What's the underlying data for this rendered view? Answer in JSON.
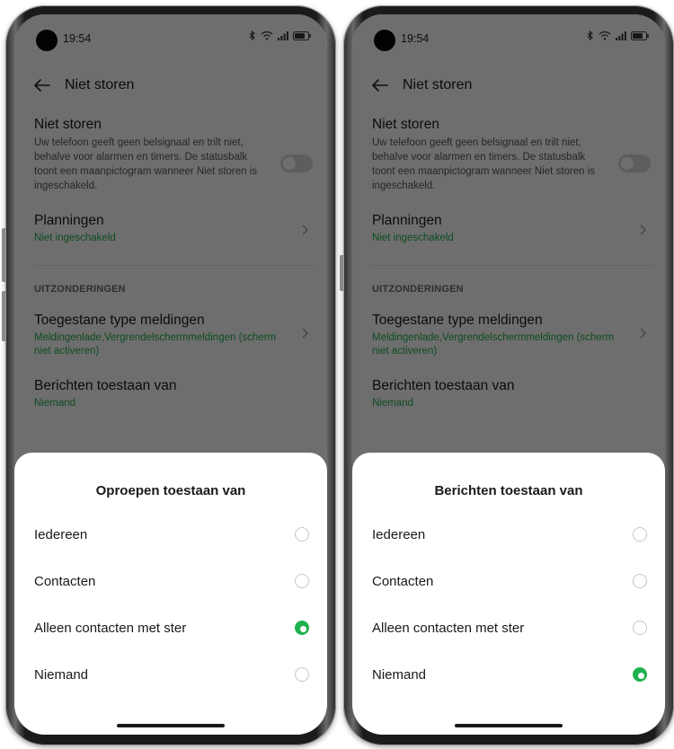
{
  "phones": [
    {
      "status": {
        "time": "19:54"
      },
      "header": {
        "title": "Niet storen"
      },
      "dnd": {
        "title": "Niet storen",
        "description": "Uw telefoon geeft geen belsignaal en trilt niet, behalve voor alarmen en timers. De statusbalk toont een maanpictogram wanneer Niet storen is ingeschakeld.",
        "toggle_on": false
      },
      "schedules": {
        "title": "Planningen",
        "value": "Niet ingeschakeld"
      },
      "exceptions_header": "UITZONDERINGEN",
      "allowed_types": {
        "title": "Toegestane type meldingen",
        "value": "Meldingenlade,Vergrendelschermmeldingen (scherm niet activeren)"
      },
      "messages_from": {
        "title": "Berichten toestaan van",
        "value": "Niemand"
      },
      "sheet": {
        "title": "Oproepen toestaan van",
        "options": [
          {
            "label": "Iedereen",
            "selected": false
          },
          {
            "label": "Contacten",
            "selected": false
          },
          {
            "label": "Alleen contacten met ster",
            "selected": true
          },
          {
            "label": "Niemand",
            "selected": false
          }
        ]
      }
    },
    {
      "status": {
        "time": "19:54"
      },
      "header": {
        "title": "Niet storen"
      },
      "dnd": {
        "title": "Niet storen",
        "description": "Uw telefoon geeft geen belsignaal en trilt niet, behalve voor alarmen en timers. De statusbalk toont een maanpictogram wanneer Niet storen is ingeschakeld.",
        "toggle_on": false
      },
      "schedules": {
        "title": "Planningen",
        "value": "Niet ingeschakeld"
      },
      "exceptions_header": "UITZONDERINGEN",
      "allowed_types": {
        "title": "Toegestane type meldingen",
        "value": "Meldingenlade,Vergrendelschermmeldingen (scherm niet activeren)"
      },
      "messages_from": {
        "title": "Berichten toestaan van",
        "value": "Niemand"
      },
      "sheet": {
        "title": "Berichten toestaan van",
        "options": [
          {
            "label": "Iedereen",
            "selected": false
          },
          {
            "label": "Contacten",
            "selected": false
          },
          {
            "label": "Alleen contacten met ster",
            "selected": false
          },
          {
            "label": "Niemand",
            "selected": true
          }
        ]
      }
    }
  ],
  "colors": {
    "accent": "#1fb24f",
    "subtext_green": "#1fa94a"
  },
  "icons": [
    "back-arrow-icon",
    "bluetooth-icon",
    "wifi-icon",
    "signal-icon",
    "battery-icon",
    "chevron-right-icon"
  ]
}
